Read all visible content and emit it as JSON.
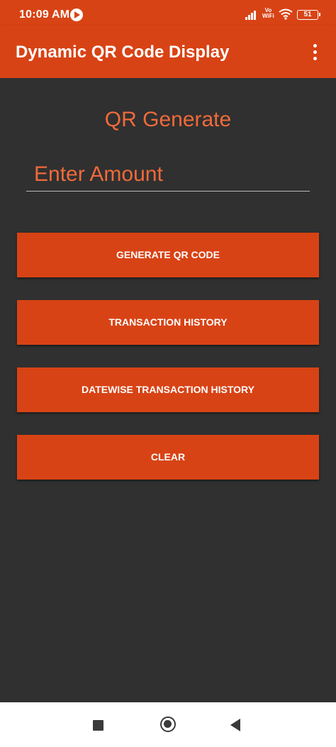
{
  "status_bar": {
    "time": "10:09 AM",
    "network_label": "Vo\nWiFi",
    "network_line1": "Vo",
    "network_line2": "WiFi",
    "battery": "51",
    "icons": [
      "play-icon",
      "signal-icon",
      "wifi-icon",
      "battery-icon"
    ]
  },
  "app_bar": {
    "title": "Dynamic QR Code Display",
    "menu_icon": "more-vert-icon"
  },
  "main": {
    "heading": "QR Generate",
    "amount_input": {
      "placeholder": "Enter Amount",
      "value": ""
    },
    "buttons": [
      {
        "label": "GENERATE QR CODE"
      },
      {
        "label": "TRANSACTION HISTORY"
      },
      {
        "label": "DATEWISE TRANSACTION HISTORY"
      },
      {
        "label": "CLEAR"
      }
    ]
  },
  "nav_bar": {
    "icons": [
      "recents-square-icon",
      "home-circle-icon",
      "back-triangle-icon"
    ]
  },
  "colors": {
    "accent": "#d84315",
    "heading_text": "#f06a3a",
    "background": "#303030",
    "nav_background": "#ffffff"
  }
}
